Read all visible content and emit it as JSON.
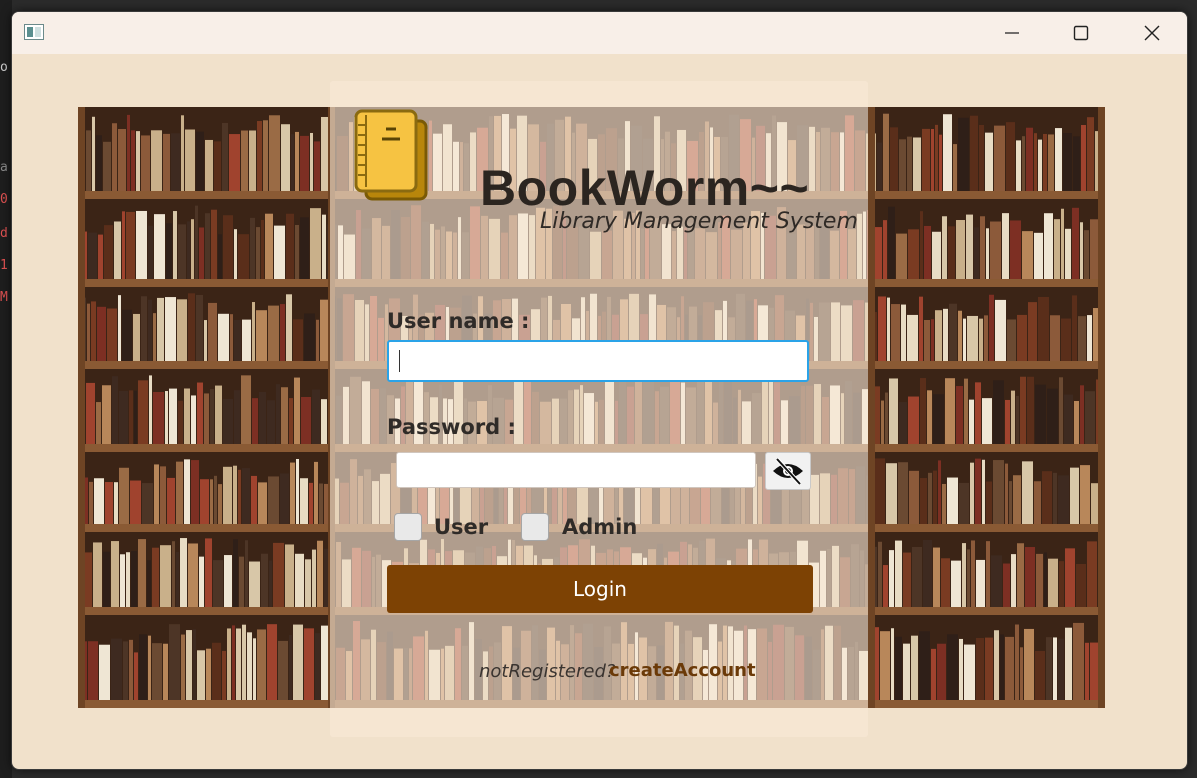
{
  "window": {
    "controls": {
      "minimize_icon": "minimize-icon",
      "maximize_icon": "maximize-icon",
      "close_icon": "close-icon"
    }
  },
  "background_editor_fragments": [
    "o",
    "a",
    "0",
    "d",
    "1",
    "M"
  ],
  "branding": {
    "title": "BookWorm~~",
    "subtitle": "Library Management System",
    "logo_icon": "book-icon"
  },
  "form": {
    "username_label": "User name :",
    "username_value": "",
    "password_label": "Password :",
    "password_value": "",
    "toggle_visibility_icon": "eye-slash-icon",
    "role_options": [
      {
        "label": "User",
        "checked": false
      },
      {
        "label": "Admin",
        "checked": false
      }
    ],
    "login_label": "Login"
  },
  "footer": {
    "question": "notRegistered?",
    "link": "createAccount"
  },
  "colors": {
    "accent_brown": "#7d4204",
    "link_brown": "#6b3a08",
    "focus_blue": "#2aa3e8",
    "window_bg": "#f1e1cb",
    "logo_yellow": "#f6c342"
  }
}
